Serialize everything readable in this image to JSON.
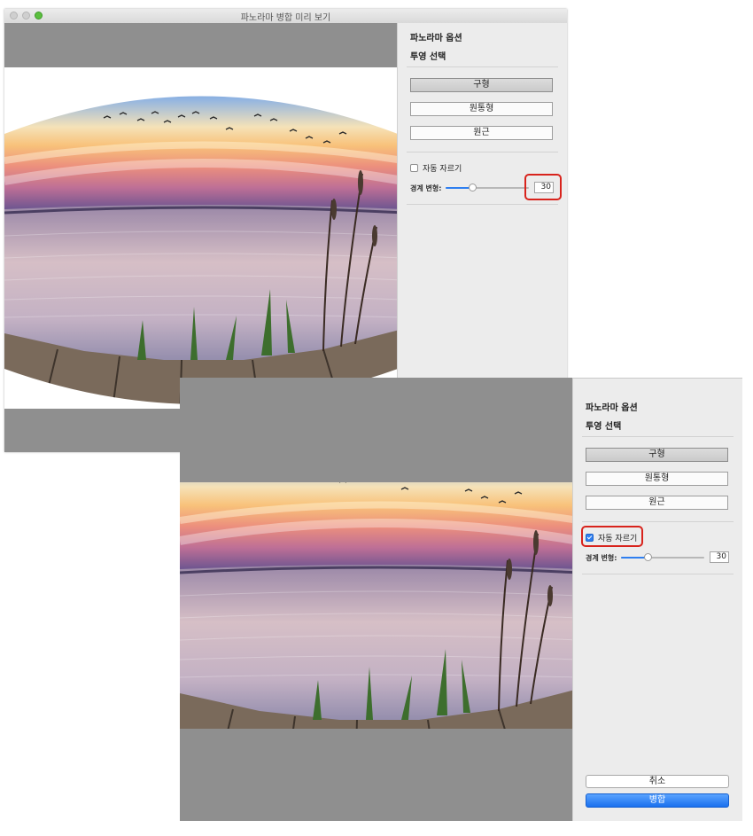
{
  "window": {
    "title": "파노라마 병합 미리 보기"
  },
  "panel": {
    "options_heading": "파노라마 옵션",
    "projection_heading": "투영 선택",
    "projections": [
      {
        "label": "구형",
        "selected": true
      },
      {
        "label": "원통형",
        "selected": false
      },
      {
        "label": "원근",
        "selected": false
      }
    ],
    "auto_crop_label": "자동 자르기",
    "boundary_warp_label": "경계 변형:",
    "cancel_label": "취소",
    "merge_label": "병합"
  },
  "state_before": {
    "auto_crop_checked": false,
    "boundary_warp_value": "30",
    "boundary_warp_fraction": 0.32
  },
  "state_after": {
    "auto_crop_checked": true,
    "boundary_warp_value": "30",
    "boundary_warp_fraction": 0.32
  },
  "colors": {
    "highlight": "#d8231c",
    "accent": "#2f7ff0",
    "preview_bg": "#8f8f8f"
  }
}
